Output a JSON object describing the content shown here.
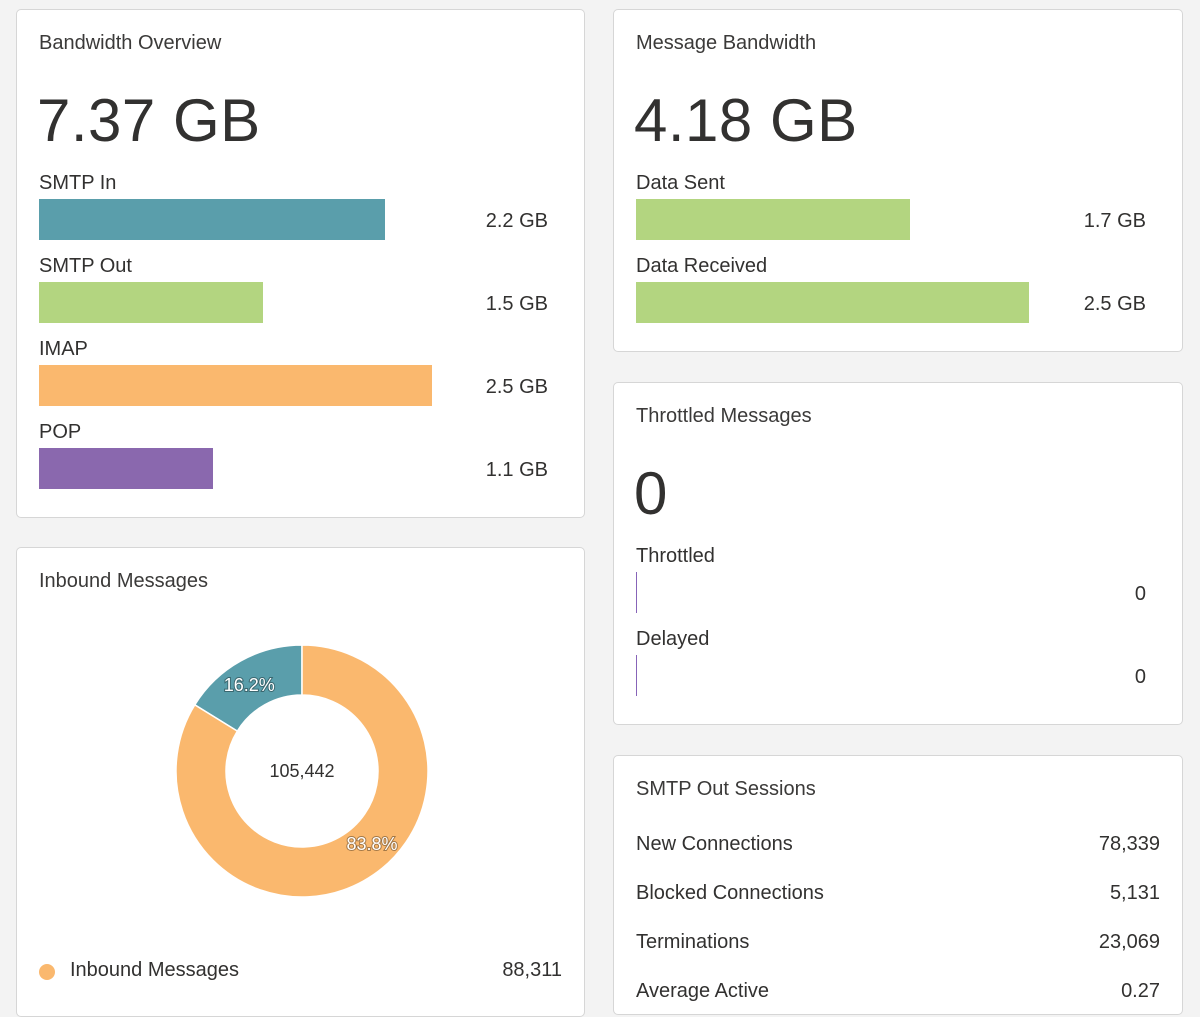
{
  "bandwidth_overview": {
    "title": "Bandwidth Overview",
    "total": "7.37 GB",
    "items": [
      {
        "label": "SMTP In",
        "value": "2.2 GB",
        "fraction": 0.745,
        "color": "#5a9eab"
      },
      {
        "label": "SMTP Out",
        "value": "1.5 GB",
        "fraction": 0.482,
        "color": "#b3d580"
      },
      {
        "label": "IMAP",
        "value": "2.5 GB",
        "fraction": 0.845,
        "color": "#fab86e"
      },
      {
        "label": "POP",
        "value": "1.1 GB",
        "fraction": 0.374,
        "color": "#8a68ae"
      }
    ]
  },
  "message_bandwidth": {
    "title": "Message Bandwidth",
    "total": "4.18 GB",
    "items": [
      {
        "label": "Data Sent",
        "value": "1.7 GB",
        "fraction": 0.59,
        "color": "#b3d580"
      },
      {
        "label": "Data Received",
        "value": "2.5 GB",
        "fraction": 0.845,
        "color": "#b3d580"
      }
    ]
  },
  "throttled_messages": {
    "title": "Throttled Messages",
    "total": "0",
    "items": [
      {
        "label": "Throttled",
        "value": "0"
      },
      {
        "label": "Delayed",
        "value": "0"
      }
    ]
  },
  "smtp_out_sessions": {
    "title": "SMTP Out Sessions",
    "rows": [
      {
        "label": "New Connections",
        "value": "78,339"
      },
      {
        "label": "Blocked Connections",
        "value": "5,131"
      },
      {
        "label": "Terminations",
        "value": "23,069"
      },
      {
        "label": "Average Active",
        "value": "0.27"
      }
    ]
  },
  "inbound_messages": {
    "title": "Inbound Messages",
    "legend": [
      {
        "label": "Inbound Messages",
        "value": "88,311",
        "color": "#fab86e"
      }
    ]
  },
  "chart_data": {
    "type": "pie",
    "title": "Inbound Messages",
    "center_label": "105,442",
    "slices": [
      {
        "label": "16.2%",
        "value": 16.2,
        "color": "#5a9eab"
      },
      {
        "label": "83.8%",
        "value": 83.8,
        "color": "#fab86e"
      }
    ]
  }
}
